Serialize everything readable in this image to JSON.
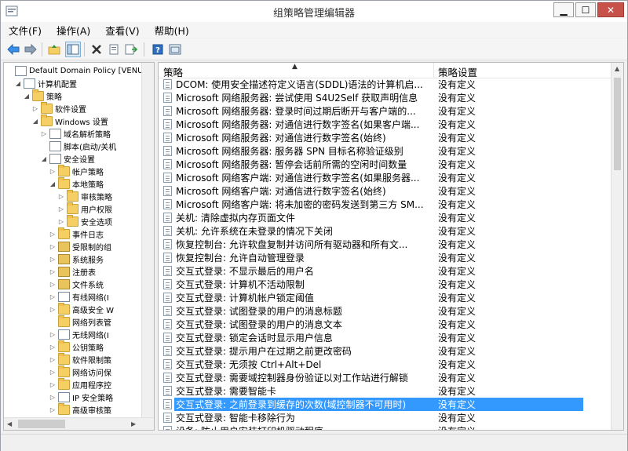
{
  "window": {
    "title": "组策略管理编辑器"
  },
  "caption": {
    "minimize": "▁",
    "maximize": "☐",
    "close": "✕"
  },
  "menu": [
    "文件(F)",
    "操作(A)",
    "查看(V)",
    "帮助(H)"
  ],
  "toolbar": {
    "icons": [
      "back-arrow-icon",
      "forward-arrow-icon",
      "up-folder-icon",
      "show-tree-icon",
      "delete-icon",
      "properties-icon",
      "export-icon",
      "help-icon",
      "console-icon"
    ]
  },
  "tree": [
    {
      "label": "Default Domain Policy [VENUS.H",
      "indent": 0,
      "toggle": "",
      "icon": "doc"
    },
    {
      "label": "计算机配置",
      "indent": 1,
      "toggle": "◢",
      "icon": "doc"
    },
    {
      "label": "策略",
      "indent": 2,
      "toggle": "◢",
      "icon": "folder"
    },
    {
      "label": "软件设置",
      "indent": 3,
      "toggle": "▷",
      "icon": "folder"
    },
    {
      "label": "Windows 设置",
      "indent": 3,
      "toggle": "◢",
      "icon": "folder"
    },
    {
      "label": "域名解析策略",
      "indent": 4,
      "toggle": "▷",
      "icon": "doc"
    },
    {
      "label": "脚本(启动/关机",
      "indent": 4,
      "toggle": "",
      "icon": "doc"
    },
    {
      "label": "安全设置",
      "indent": 4,
      "toggle": "◢",
      "icon": "doc"
    },
    {
      "label": "帐户策略",
      "indent": 5,
      "toggle": "▷",
      "icon": "folder"
    },
    {
      "label": "本地策略",
      "indent": 5,
      "toggle": "◢",
      "icon": "folder"
    },
    {
      "label": "审核策略",
      "indent": 6,
      "toggle": "▷",
      "icon": "folder"
    },
    {
      "label": "用户权限",
      "indent": 6,
      "toggle": "▷",
      "icon": "folder"
    },
    {
      "label": "安全选项",
      "indent": 6,
      "toggle": "▷",
      "icon": "folder"
    },
    {
      "label": "事件日志",
      "indent": 5,
      "toggle": "▷",
      "icon": "folder"
    },
    {
      "label": "受限制的组",
      "indent": 5,
      "toggle": "▷",
      "icon": "lock"
    },
    {
      "label": "系统服务",
      "indent": 5,
      "toggle": "▷",
      "icon": "lock"
    },
    {
      "label": "注册表",
      "indent": 5,
      "toggle": "▷",
      "icon": "lock"
    },
    {
      "label": "文件系统",
      "indent": 5,
      "toggle": "▷",
      "icon": "lock"
    },
    {
      "label": "有线网络(I",
      "indent": 5,
      "toggle": "▷",
      "icon": "doc"
    },
    {
      "label": "高级安全 W",
      "indent": 5,
      "toggle": "▷",
      "icon": "folder"
    },
    {
      "label": "网络列表管",
      "indent": 5,
      "toggle": "",
      "icon": "folder"
    },
    {
      "label": "无线网络(I",
      "indent": 5,
      "toggle": "▷",
      "icon": "doc"
    },
    {
      "label": "公钥策略",
      "indent": 5,
      "toggle": "▷",
      "icon": "folder"
    },
    {
      "label": "软件限制策",
      "indent": 5,
      "toggle": "▷",
      "icon": "folder"
    },
    {
      "label": "网络访问保",
      "indent": 5,
      "toggle": "▷",
      "icon": "folder"
    },
    {
      "label": "应用程序控",
      "indent": 5,
      "toggle": "▷",
      "icon": "folder"
    },
    {
      "label": "IP 安全策略",
      "indent": 5,
      "toggle": "▷",
      "icon": "doc"
    },
    {
      "label": "高级审核策",
      "indent": 5,
      "toggle": "▷",
      "icon": "folder"
    }
  ],
  "list": {
    "col_policy": "策略",
    "col_setting": "策略设置",
    "rows": [
      {
        "policy": "DCOM: 使用安全描述符定义语言(SDDL)语法的计算机启...",
        "setting": "没有定义"
      },
      {
        "policy": "Microsoft 网络服务器: 尝试使用 S4U2Self 获取声明信息",
        "setting": "没有定义"
      },
      {
        "policy": "Microsoft 网络服务器: 登录时间过期后断开与客户端的...",
        "setting": "没有定义"
      },
      {
        "policy": "Microsoft 网络服务器: 对通信进行数字签名(如果客户端...",
        "setting": "没有定义"
      },
      {
        "policy": "Microsoft 网络服务器: 对通信进行数字签名(始终)",
        "setting": "没有定义"
      },
      {
        "policy": "Microsoft 网络服务器: 服务器 SPN 目标名称验证级别",
        "setting": "没有定义"
      },
      {
        "policy": "Microsoft 网络服务器: 暂停会话前所需的空闲时间数量",
        "setting": "没有定义"
      },
      {
        "policy": "Microsoft 网络客户端: 对通信进行数字签名(如果服务器...",
        "setting": "没有定义"
      },
      {
        "policy": "Microsoft 网络客户端: 对通信进行数字签名(始终)",
        "setting": "没有定义"
      },
      {
        "policy": "Microsoft 网络客户端: 将未加密的密码发送到第三方 SM...",
        "setting": "没有定义"
      },
      {
        "policy": "关机: 清除虚拟内存页面文件",
        "setting": "没有定义"
      },
      {
        "policy": "关机: 允许系统在未登录的情况下关闭",
        "setting": "没有定义"
      },
      {
        "policy": "恢复控制台: 允许软盘复制并访问所有驱动器和所有文...",
        "setting": "没有定义"
      },
      {
        "policy": "恢复控制台: 允许自动管理登录",
        "setting": "没有定义"
      },
      {
        "policy": "交互式登录: 不显示最后的用户名",
        "setting": "没有定义"
      },
      {
        "policy": "交互式登录: 计算机不活动限制",
        "setting": "没有定义"
      },
      {
        "policy": "交互式登录: 计算机帐户锁定阈值",
        "setting": "没有定义"
      },
      {
        "policy": "交互式登录: 试图登录的用户的消息标题",
        "setting": "没有定义"
      },
      {
        "policy": "交互式登录: 试图登录的用户的消息文本",
        "setting": "没有定义"
      },
      {
        "policy": "交互式登录: 锁定会话时显示用户信息",
        "setting": "没有定义"
      },
      {
        "policy": "交互式登录: 提示用户在过期之前更改密码",
        "setting": "没有定义"
      },
      {
        "policy": "交互式登录: 无须按 Ctrl+Alt+Del",
        "setting": "没有定义"
      },
      {
        "policy": "交互式登录: 需要域控制器身份验证以对工作站进行解锁",
        "setting": "没有定义"
      },
      {
        "policy": "交互式登录: 需要智能卡",
        "setting": "没有定义"
      },
      {
        "policy": "交互式登录: 之前登录到缓存的次数(域控制器不可用时)",
        "setting": "没有定义",
        "selected": true
      },
      {
        "policy": "交互式登录: 智能卡移除行为",
        "setting": "没有定义"
      },
      {
        "policy": "设备: 防止用户安装打印机驱动程序",
        "setting": "没有定义"
      }
    ]
  }
}
